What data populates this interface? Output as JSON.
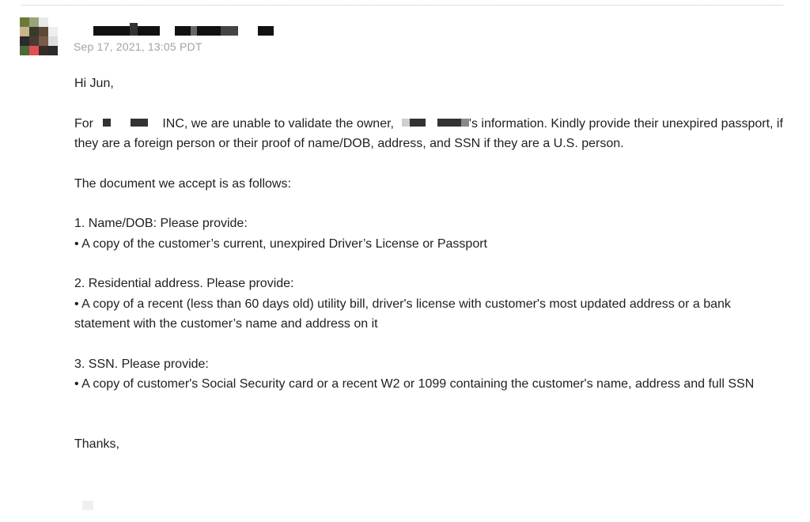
{
  "email": {
    "timestamp": "Sep 17, 2021, 13:05 PDT",
    "greeting": "Hi Jun,",
    "p1_for": "For",
    "p1_after_company": "INC, we are unable to validate the owner,",
    "p1_after_owner": "'s information. Kindly provide their unexpired passport, if they are a foreign person or their proof of name/DOB, address, and SSN if they are a U.S. person.",
    "p2": "The document we accept is as follows:",
    "item1_heading": "1. Name/DOB: Please provide:",
    "item1_bullet": "• A copy of the customer’s current, unexpired Driver’s License or Passport",
    "item2_heading": "2. Residential address. Please provide:",
    "item2_bullet": "• A copy of a recent (less than 60 days old) utility bill, driver's license with customer's most updated address or a bank statement with the customer’s name and address on it",
    "item3_heading": "3. SSN. Please provide:",
    "item3_bullet": "• A copy of customer's Social Security card or a recent W2 or 1099 containing the customer's name, address and full SSN",
    "closing": "Thanks,"
  },
  "colors": {
    "timestamp": "#a3a3a3",
    "text": "#1f1f1f",
    "divider": "#bfbfbf"
  }
}
